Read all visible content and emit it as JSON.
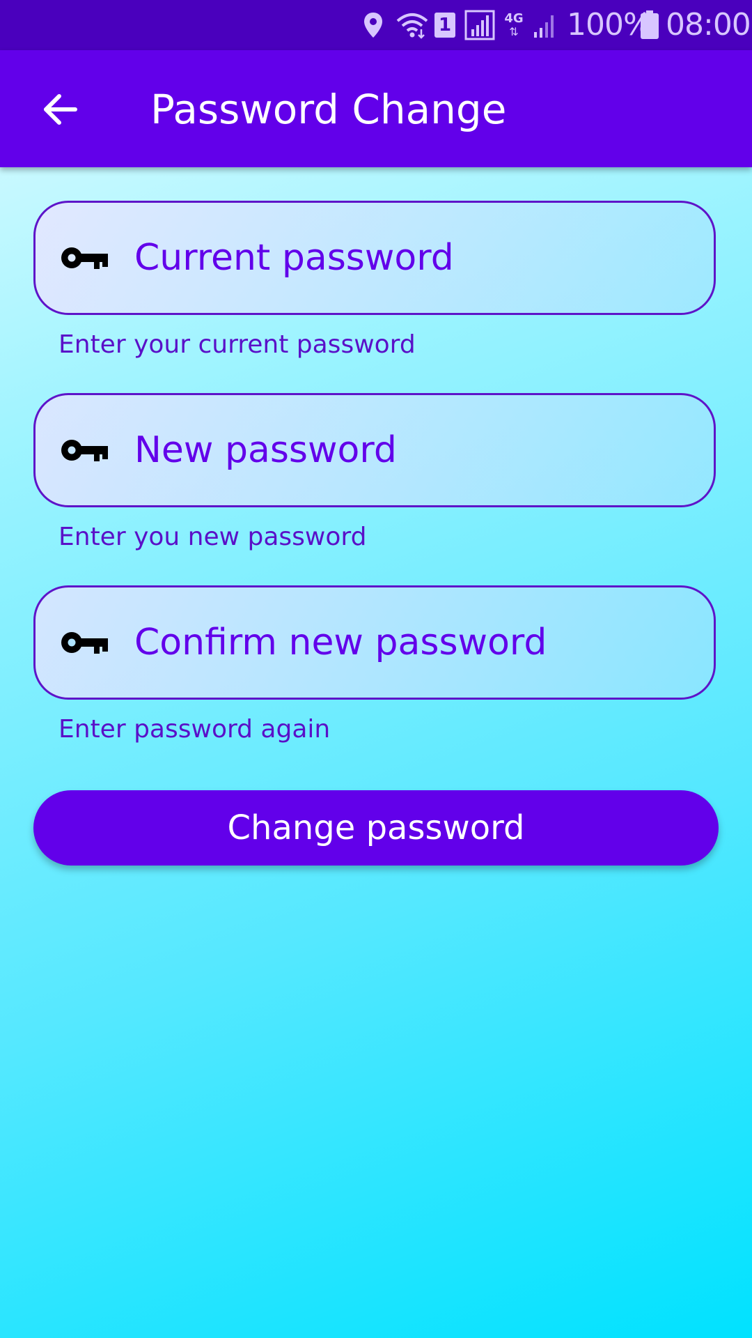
{
  "status_bar": {
    "battery_percent": "100%",
    "time": "08:00",
    "icons": [
      "location-icon",
      "wifi-icon",
      "sim-1-icon",
      "signal-icon",
      "4g-icon",
      "signal-weak-icon",
      "battery-icon"
    ],
    "sim_label": "1",
    "network_label": "4G"
  },
  "app_bar": {
    "title": "Password Change",
    "back_icon": "arrow-back-icon"
  },
  "form": {
    "current_password": {
      "placeholder": "Current password",
      "value": "",
      "helper": "Enter your current password",
      "icon": "key-icon"
    },
    "new_password": {
      "placeholder": "New password",
      "value": "",
      "helper": "Enter you new password",
      "icon": "key-icon"
    },
    "confirm_password": {
      "placeholder": "Confirm new password",
      "value": "",
      "helper": "Enter password again",
      "icon": "key-icon"
    },
    "submit_label": "Change password"
  },
  "colors": {
    "primary": "#6200ea",
    "status_bar": "#4a00bd",
    "field_border": "#5e14c9",
    "background_start": "#e2fcff",
    "background_end": "#00e2ff"
  }
}
